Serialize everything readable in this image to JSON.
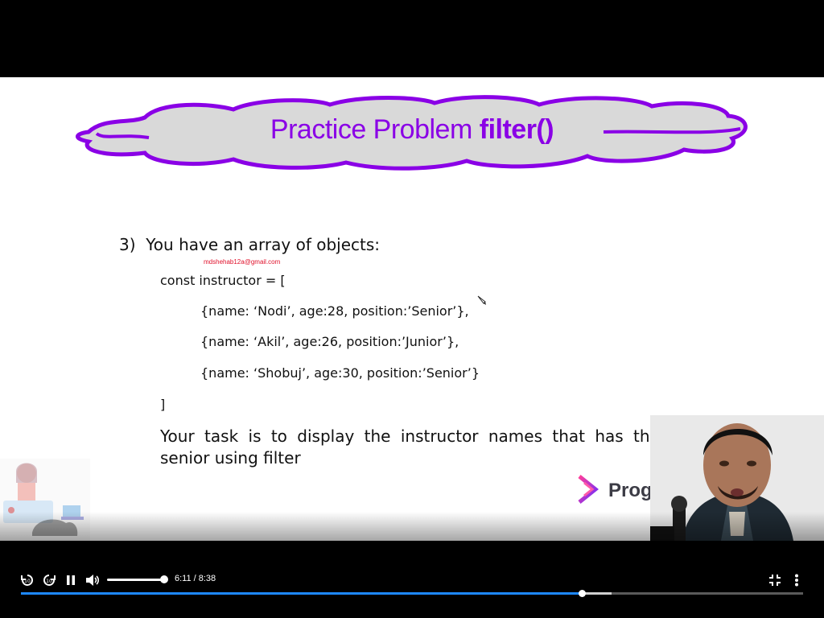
{
  "slide": {
    "title_regular": "Practice Problem ",
    "title_bold": "filter()",
    "problem_number": "3)",
    "problem_text": "You have an array of objects:",
    "watermark": "mdshehab12a@gmail.com",
    "code_lines": [
      "const instructor = [",
      "{name: ‘Nodi’, age:28, position:’Senior’},",
      "{name: ‘Akil’, age:26, position:’Junior’},",
      "{name: ‘Shobuj’, age:30, position:’Senior’}",
      "]"
    ],
    "task_line1": "Your task is to display the instructor names that has the positi",
    "task_line2": "senior using filter",
    "brand": "Programm    ero"
  },
  "player": {
    "time_display": "6:11 / 8:38",
    "progress_fraction": 0.7181,
    "buffered_fraction": 0.755,
    "volume_fraction": 1.0,
    "icons": [
      "replay-10-icon",
      "forward-10-icon",
      "pause-icon",
      "volume-icon",
      "exit-fullscreen-icon",
      "more-options-icon"
    ]
  },
  "colors": {
    "title_purple": "#8a00e6",
    "cloud_fill": "#d9d9d9",
    "progress_blue": "#1e88ff"
  }
}
